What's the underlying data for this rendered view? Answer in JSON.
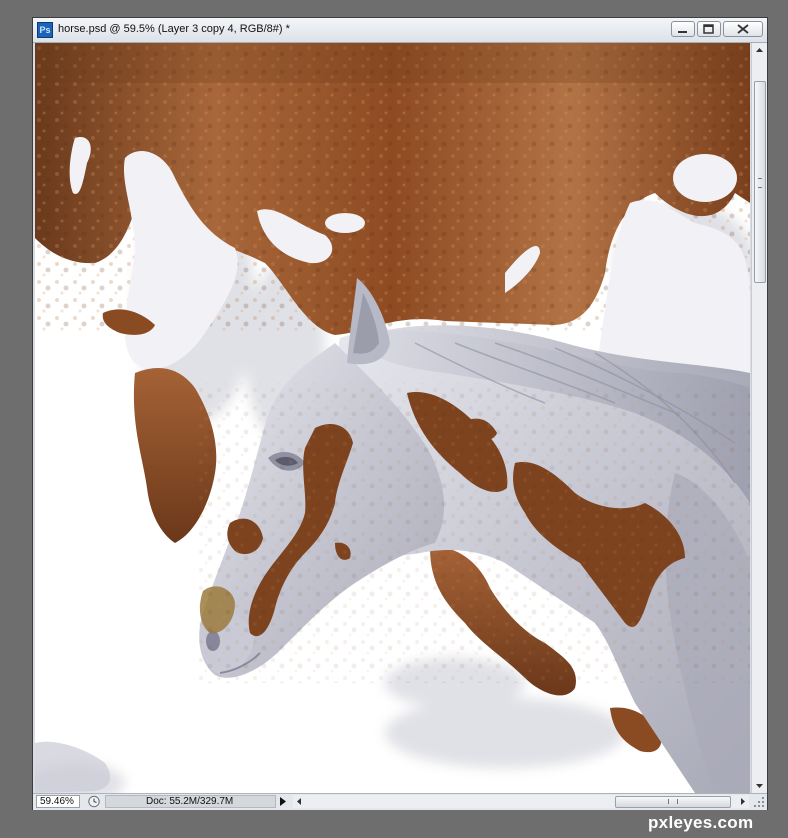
{
  "window": {
    "app_icon": "photoshop-icon",
    "app_icon_text": "Ps",
    "title": "horse.psd @ 59.5% (Layer 3 copy 4, RGB/8#) *",
    "buttons": [
      "minimize-icon",
      "restore-icon",
      "close-icon"
    ]
  },
  "canvas": {
    "content": "horse-painting-image"
  },
  "status": {
    "zoom": "59.46%",
    "doc_info": "Doc: 55.2M/329.7M"
  },
  "watermark": "pxleyes.com",
  "colors": {
    "background": "#6e6e6e",
    "chrome": "#d9dde3",
    "photoshop_blue": "#1b63b6",
    "bark_brown": "#8e4b22",
    "horse_grey": "#b9bac6"
  }
}
